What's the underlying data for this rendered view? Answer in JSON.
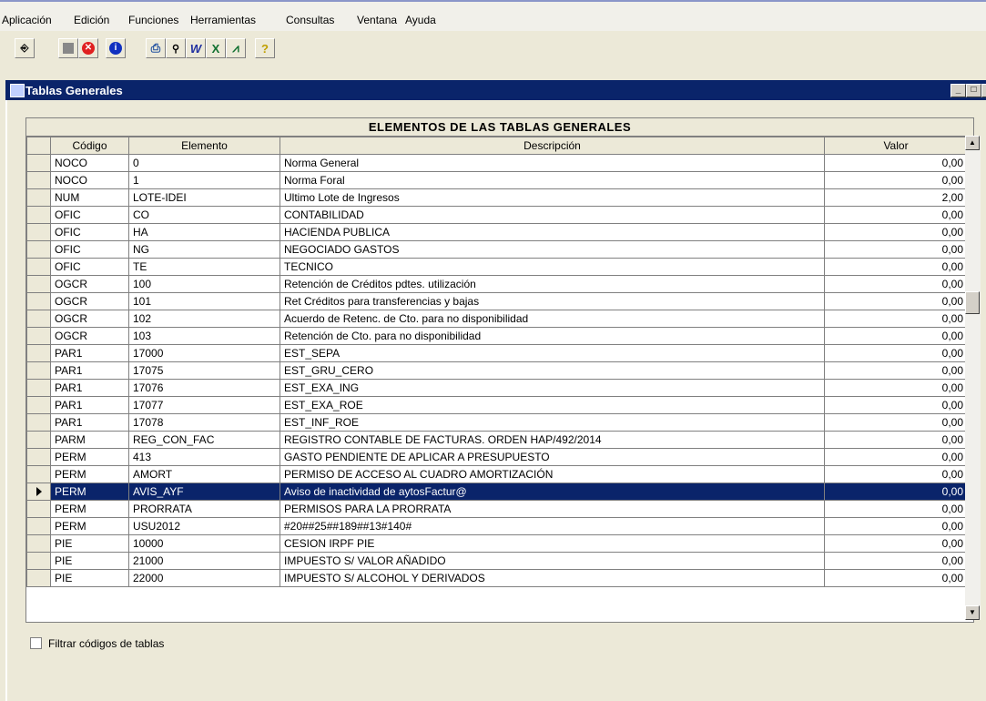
{
  "menu": [
    "Aplicación",
    "Edición",
    "Funciones",
    "Herramientas",
    "Consultas",
    "Ventana",
    "Ayuda"
  ],
  "window": {
    "title": "Tablas Generales"
  },
  "grid": {
    "title": "ELEMENTOS DE LAS TABLAS GENERALES",
    "columns": [
      "Código",
      "Elemento",
      "Descripción",
      "Valor"
    ],
    "rows": [
      [
        "NOCO",
        "0",
        "Norma General",
        "0,00"
      ],
      [
        "NOCO",
        "1",
        "Norma Foral",
        "0,00"
      ],
      [
        "NUM",
        "LOTE-IDEI",
        "Ultimo Lote de Ingresos",
        "2,00"
      ],
      [
        "OFIC",
        "CO",
        "CONTABILIDAD",
        "0,00"
      ],
      [
        "OFIC",
        "HA",
        "HACIENDA PUBLICA",
        "0,00"
      ],
      [
        "OFIC",
        "NG",
        "NEGOCIADO GASTOS",
        "0,00"
      ],
      [
        "OFIC",
        "TE",
        "TECNICO",
        "0,00"
      ],
      [
        "OGCR",
        "100",
        "Retención de Créditos pdtes. utilización",
        "0,00"
      ],
      [
        "OGCR",
        "101",
        "Ret Créditos para transferencias y bajas",
        "0,00"
      ],
      [
        "OGCR",
        "102",
        "Acuerdo de Retenc. de Cto. para no disponibilidad",
        "0,00"
      ],
      [
        "OGCR",
        "103",
        "Retención de Cto. para no disponibilidad",
        "0,00"
      ],
      [
        "PAR1",
        "17000",
        "EST_SEPA",
        "0,00"
      ],
      [
        "PAR1",
        "17075",
        "EST_GRU_CERO",
        "0,00"
      ],
      [
        "PAR1",
        "17076",
        "EST_EXA_ING",
        "0,00"
      ],
      [
        "PAR1",
        "17077",
        "EST_EXA_ROE",
        "0,00"
      ],
      [
        "PAR1",
        "17078",
        "EST_INF_ROE",
        "0,00"
      ],
      [
        "PARM",
        "REG_CON_FAC",
        "REGISTRO CONTABLE DE FACTURAS. ORDEN HAP/492/2014",
        "0,00"
      ],
      [
        "PERM",
        "413",
        "GASTO PENDIENTE DE APLICAR A PRESUPUESTO",
        "0,00"
      ],
      [
        "PERM",
        "AMORT",
        "PERMISO DE ACCESO AL CUADRO AMORTIZACIÓN",
        "0,00"
      ],
      [
        "PERM",
        "AVIS_AYF",
        "Aviso de inactividad de aytosFactur@",
        "0,00"
      ],
      [
        "PERM",
        "PRORRATA",
        "PERMISOS PARA LA PRORRATA",
        "0,00"
      ],
      [
        "PERM",
        "USU2012",
        "#20##25##189##13#140#",
        "0,00"
      ],
      [
        "PIE",
        "10000",
        "CESION IRPF PIE",
        "0,00"
      ],
      [
        "PIE",
        "21000",
        "IMPUESTO S/ VALOR AÑADIDO",
        "0,00"
      ],
      [
        "PIE",
        "22000",
        "IMPUESTO S/ ALCOHOL Y DERIVADOS",
        "0,00"
      ]
    ],
    "selected_row": 19
  },
  "filter": {
    "label": "Filtrar códigos de tablas",
    "checked": false
  }
}
